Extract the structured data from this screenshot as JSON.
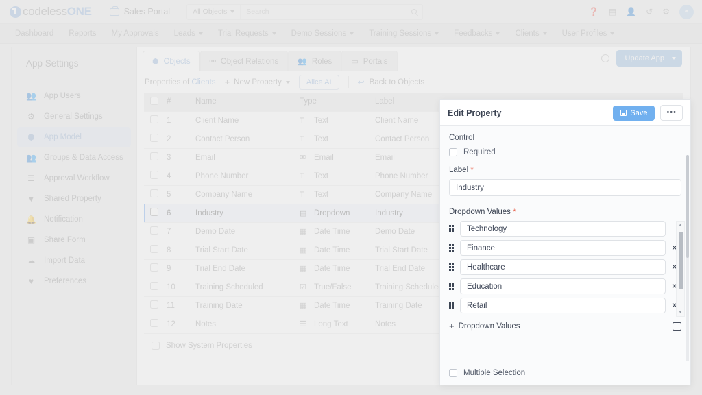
{
  "topbar": {
    "logo_light": "codeless",
    "logo_bold": "ONE",
    "portal_name": "Sales Portal",
    "portal_icon": "briefcase-icon",
    "search_scope": "All Objects",
    "search_placeholder": "Search",
    "search_value": "",
    "icons": [
      "help-icon",
      "database-icon",
      "add-user-icon",
      "history-icon",
      "gear-icon",
      "avatar-icon"
    ]
  },
  "nav": {
    "items": [
      {
        "label": "Dashboard",
        "has_caret": false
      },
      {
        "label": "Reports",
        "has_caret": false
      },
      {
        "label": "My Approvals",
        "has_caret": false
      },
      {
        "label": "Leads",
        "has_caret": true
      },
      {
        "label": "Trial Requests",
        "has_caret": true
      },
      {
        "label": "Demo Sessions",
        "has_caret": true
      },
      {
        "label": "Training Sessions",
        "has_caret": true
      },
      {
        "label": "Feedbacks",
        "has_caret": true
      },
      {
        "label": "Clients",
        "has_caret": true
      },
      {
        "label": "User Profiles",
        "has_caret": true
      }
    ]
  },
  "sidebar": {
    "title": "App Settings",
    "items": [
      {
        "label": "App Users",
        "icon": "users-icon",
        "active": false
      },
      {
        "label": "General Settings",
        "icon": "gear-icon",
        "active": false
      },
      {
        "label": "App Model",
        "icon": "cube-icon",
        "active": true
      },
      {
        "label": "Groups & Data Access",
        "icon": "group-icon",
        "active": false
      },
      {
        "label": "Approval Workflow",
        "icon": "checklist-icon",
        "active": false
      },
      {
        "label": "Shared Property",
        "icon": "tag-icon",
        "active": false
      },
      {
        "label": "Notification",
        "icon": "bell-icon",
        "active": false
      },
      {
        "label": "Share Form",
        "icon": "form-icon",
        "active": false
      },
      {
        "label": "Import Data",
        "icon": "cloud-upload-icon",
        "active": false
      },
      {
        "label": "Preferences",
        "icon": "hand-heart-icon",
        "active": false
      }
    ]
  },
  "tabs": [
    {
      "label": "Objects",
      "icon": "cube-icon",
      "active": true
    },
    {
      "label": "Object Relations",
      "icon": "sitemap-icon",
      "active": false
    },
    {
      "label": "Roles",
      "icon": "users-icon",
      "active": false
    },
    {
      "label": "Portals",
      "icon": "window-icon",
      "active": false
    }
  ],
  "tabbar_right": {
    "info_icon": "info-icon",
    "update_label": "Update App"
  },
  "toolbar": {
    "properties_of": "Properties of",
    "object_name": "Clients",
    "new_property": "New Property",
    "alice_ai": "Alice AI",
    "back_to_objects": "Back to Objects"
  },
  "table": {
    "columns": [
      "",
      "#",
      "Name",
      "Type",
      "Label"
    ],
    "rows": [
      {
        "num": "1",
        "name": "Client Name",
        "type": "Text",
        "type_icon": "text-icon",
        "label": "Client Name",
        "selected": false
      },
      {
        "num": "2",
        "name": "Contact Person",
        "type": "Text",
        "type_icon": "text-icon",
        "label": "Contact Person",
        "selected": false
      },
      {
        "num": "3",
        "name": "Email",
        "type": "Email",
        "type_icon": "envelope-icon",
        "label": "Email",
        "selected": false
      },
      {
        "num": "4",
        "name": "Phone Number",
        "type": "Text",
        "type_icon": "text-icon",
        "label": "Phone Number",
        "selected": false
      },
      {
        "num": "5",
        "name": "Company Name",
        "type": "Text",
        "type_icon": "text-icon",
        "label": "Company Name",
        "selected": false
      },
      {
        "num": "6",
        "name": "Industry",
        "type": "Dropdown",
        "type_icon": "dropdown-icon",
        "label": "Industry",
        "selected": true
      },
      {
        "num": "7",
        "name": "Demo Date",
        "type": "Date Time",
        "type_icon": "calendar-icon",
        "label": "Demo Date",
        "selected": false
      },
      {
        "num": "8",
        "name": "Trial Start Date",
        "type": "Date Time",
        "type_icon": "calendar-icon",
        "label": "Trial Start Date",
        "selected": false
      },
      {
        "num": "9",
        "name": "Trial End Date",
        "type": "Date Time",
        "type_icon": "calendar-icon",
        "label": "Trial End Date",
        "selected": false
      },
      {
        "num": "10",
        "name": "Training Scheduled",
        "type": "True/False",
        "type_icon": "checkbox-icon",
        "label": "Training Scheduled",
        "selected": false
      },
      {
        "num": "11",
        "name": "Training Date",
        "type": "Date Time",
        "type_icon": "calendar-icon",
        "label": "Training Date",
        "selected": false
      },
      {
        "num": "12",
        "name": "Notes",
        "type": "Long Text",
        "type_icon": "longtext-icon",
        "label": "Notes",
        "selected": false
      }
    ],
    "show_system_properties": "Show System Properties"
  },
  "panel": {
    "title": "Edit Property",
    "save_label": "Save",
    "more_label": "•••",
    "control_label": "Control",
    "required_label": "Required",
    "required_checked": false,
    "label_field": {
      "label": "Label",
      "required_mark": "*",
      "value": "Industry",
      "placeholder": ""
    },
    "dropdown_values": {
      "label": "Dropdown Values",
      "required_mark": "*",
      "items": [
        {
          "value": "Technology",
          "removable": false
        },
        {
          "value": "Finance",
          "removable": true
        },
        {
          "value": "Healthcare",
          "removable": true
        },
        {
          "value": "Education",
          "removable": true
        },
        {
          "value": "Retail",
          "removable": true
        }
      ],
      "add_label": "Dropdown Values",
      "add_plus": "+",
      "remove_glyph": "✕",
      "bulk_icon": "add-box-icon"
    },
    "multiple_selection": {
      "label": "Multiple Selection",
      "checked": false
    }
  },
  "colors": {
    "accent": "#8ab0dd",
    "save_button": "#71b0ef",
    "selected_row_border": "#5b9bef",
    "selected_row_bg": "#eff5fd",
    "required_star": "#e8654f",
    "panel_bg": "#fafbfc"
  }
}
